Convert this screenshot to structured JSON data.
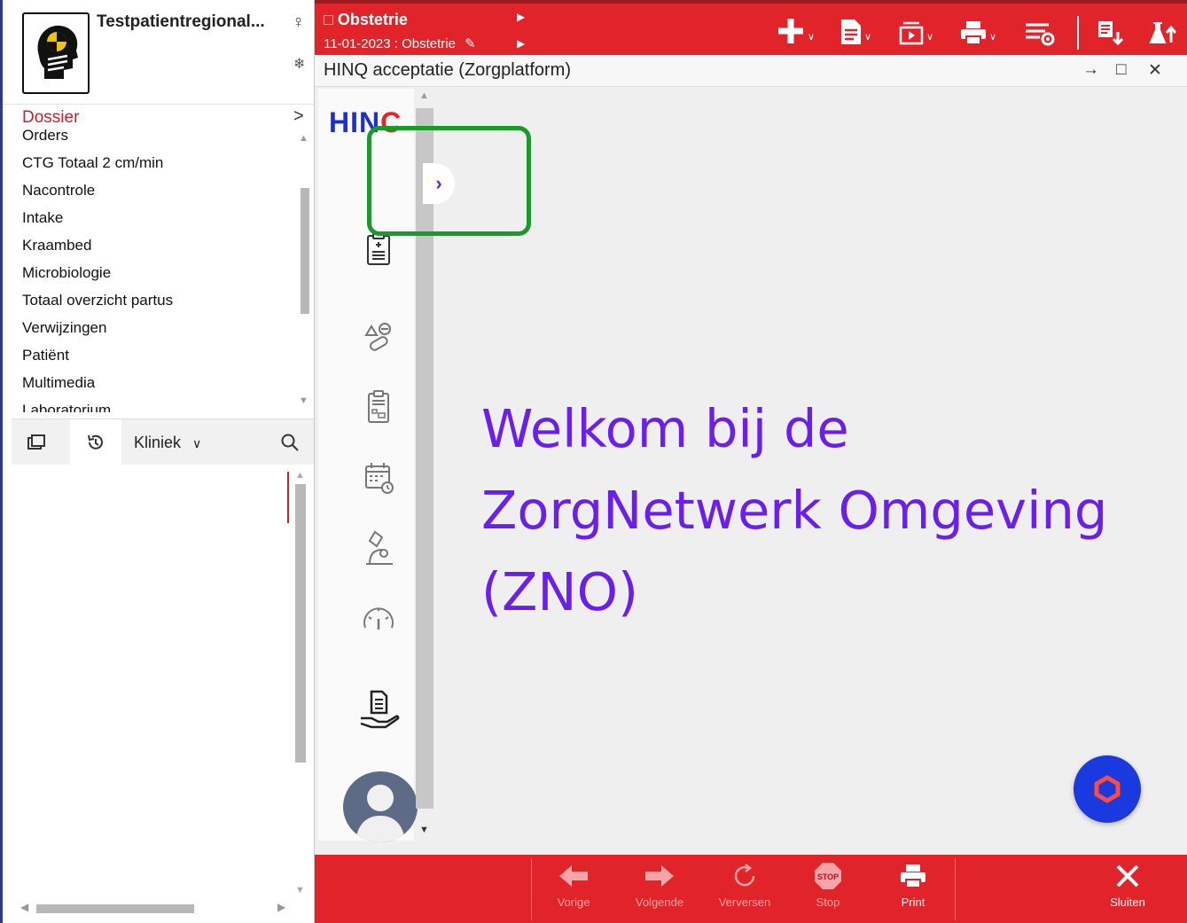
{
  "patient": {
    "name": "Testpatientregional...",
    "gender_symbol": "♀",
    "flag_symbol": "❄"
  },
  "dossier": {
    "label": "Dossier",
    "items": [
      "Orders",
      "CTG Totaal 2 cm/min",
      "Nacontrole",
      "Intake",
      "Kraambed",
      "Microbiologie",
      "Totaal overzicht partus",
      "Verwijzingen",
      "Patiënt",
      "Multimedia",
      "Laboratorium"
    ]
  },
  "lower_toolbar": {
    "filter_label": "Kliniek"
  },
  "context": {
    "title": "Obstetrie",
    "subtitle": "11-01-2023 : Obstetrie"
  },
  "window": {
    "title": "HINQ acceptatie (Zorgplatform)"
  },
  "hinq": {
    "logo_text": "HIN",
    "logo_tail": "C",
    "welcome_line1": "Welkom bij de",
    "welcome_line2": "ZorgNetwerk Omgeving",
    "welcome_line3": "(ZNO)"
  },
  "bottom_buttons": {
    "prev": "Vorige",
    "next": "Volgende",
    "refresh": "Verversen",
    "stop": "Stop",
    "stop_badge": "STOP",
    "print": "Print",
    "close": "Sluiten"
  },
  "colors": {
    "brand_red": "#e0242a",
    "welcome_purple": "#6a1ff0",
    "fab_blue": "#1a3ae0",
    "highlight_green": "#1a9a2a",
    "dossier_red": "#c8202f"
  }
}
